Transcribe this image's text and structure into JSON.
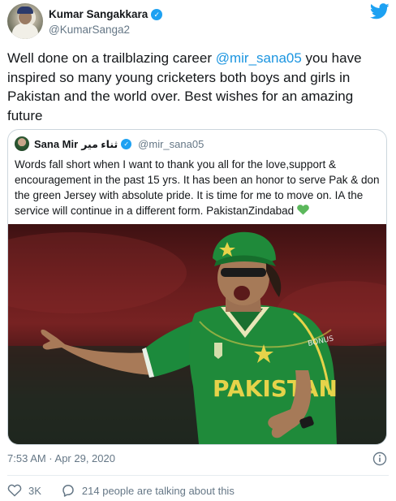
{
  "author": {
    "display_name": "Kumar Sangakkara",
    "handle": "@KumarSanga2"
  },
  "tweet": {
    "text_before": "Well done on a trailblazing career ",
    "mention": "@mir_sana05",
    "text_after": " you have inspired so many young cricketers both boys and girls in Pakistan and the world over. Best wishes for an amazing future"
  },
  "quoted_tweet": {
    "display_name": "Sana Mir",
    "urdu_name": "ثناء میر",
    "handle": "@mir_sana05",
    "text": "Words fall short when I want to thank you all for the love,support & encouragement in the past 15 yrs. It has been an honor to serve Pak & don the green Jersey with absolute pride. It is time for me to move on. IA the service will continue in a different form. PakistanZindabad",
    "emoji": "green-heart-icon",
    "jersey_text": "PAKISTAN"
  },
  "timestamp": "7:53 AM · Apr 29, 2020",
  "actions": {
    "likes": "3K",
    "conversation": "214 people are talking about this"
  },
  "colors": {
    "link": "#1b95e0",
    "twitter_blue": "#1da1f2",
    "muted": "#657786",
    "jersey_green": "#1f8a3a"
  }
}
